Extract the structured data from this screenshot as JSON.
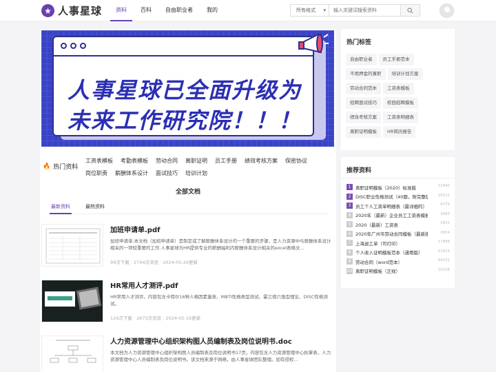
{
  "header": {
    "logo_text": "人事星球",
    "nav": [
      "资料",
      "百科",
      "自由职业者",
      "我的"
    ],
    "search_select": "所有格式",
    "search_placeholder": "输入关键词搜索资料"
  },
  "banner": {
    "line1": "人事星球已全面升级为",
    "line2": "未来工作研究院！！！"
  },
  "hot": {
    "label": "热门资料",
    "links": [
      "工资表模板",
      "考勤表模板",
      "劳动合同",
      "离职证明",
      "员工手册",
      "绩效考核方案",
      "保密协议",
      "岗位职责",
      "薪酬体系设计",
      "面试技巧",
      "培训计划"
    ]
  },
  "docs_section": {
    "title": "全部文档",
    "tabs": [
      "最新资料",
      "最热资料"
    ]
  },
  "docs": [
    {
      "title": "加班申请单.pdf",
      "desc": "加班申请单,本文档（加班申请单）是制定或了解薪酬体系设计的一个重要的步骤，是人力资源中与薪酬体系设计相关的一项较重要的工作.人事星球为HR提供专业的薪酬福利内薪酬体系设计相关的excel表格文...",
      "meta": "99次下载 · 2744次浏览 · 2024-05-29更新"
    },
    {
      "title": "HR常用人才测评.pdf",
      "desc": "HR常用人才测评，内容包含卡特尔16种人格因素量表、MBTI性格类型测试、霍兰德六角型理论、DISC性格测试。",
      "meta": "126次下载 · 2673次浏览 · 2024-05-16更新"
    },
    {
      "title": "人力资源管理中心组织架构图人员编制表及岗位说明书.doc",
      "desc": "本文档为人力资源管理中心组织架构图人员编制表及岗位说明书17页，内容包含人力资源管理中心执掌表，人力资源管理中心人员编制表及岗位说明书。该文档来源于网络，由人事星球团队整理。如有侵权...",
      "meta": ""
    }
  ],
  "sidebar": {
    "hot_tags_title": "热门标签",
    "tags": [
      "自由职业者",
      "员工手册范本",
      "不用押金的兼职",
      "培训计划方案",
      "劳动合同范本",
      "工资表模板",
      "招聘面试技巧",
      "校园招聘模板",
      "绩效考核方案",
      "工资表明细表",
      "离职证明模板",
      "HR简历报告"
    ],
    "recommend_title": "推荐资料",
    "recommend": [
      {
        "num": "1",
        "title": "离职证明模板（2020）标准版",
        "count": "12940"
      },
      {
        "num": "2",
        "title": "DISC职业性格测试（40题，附完整版）",
        "count": "10521"
      },
      {
        "num": "3",
        "title": "员工个人工资单明细表（最详细的）",
        "count": "4776"
      },
      {
        "num": "4",
        "title": "2020年（最新）企业员工工资表模板",
        "count": "3983"
      },
      {
        "num": "5",
        "title": "2020（最新）工资表",
        "count": "1855"
      },
      {
        "num": "6",
        "title": "2020年广州市劳动合同模板（最新版）",
        "count": "3654"
      },
      {
        "num": "7",
        "title": "上海退工单（可打印）",
        "count": "17896"
      },
      {
        "num": "8",
        "title": "个人收入证明模板范本（通用版）",
        "count": "51915"
      },
      {
        "num": "9",
        "title": "劳动合同（word范本）",
        "count": "94032"
      },
      {
        "num": "10",
        "title": "离职证明模板（正规）",
        "count": "15108"
      }
    ]
  },
  "colors": {
    "accent": "#6a3fb0",
    "banner_bg": "#3a43c8"
  }
}
